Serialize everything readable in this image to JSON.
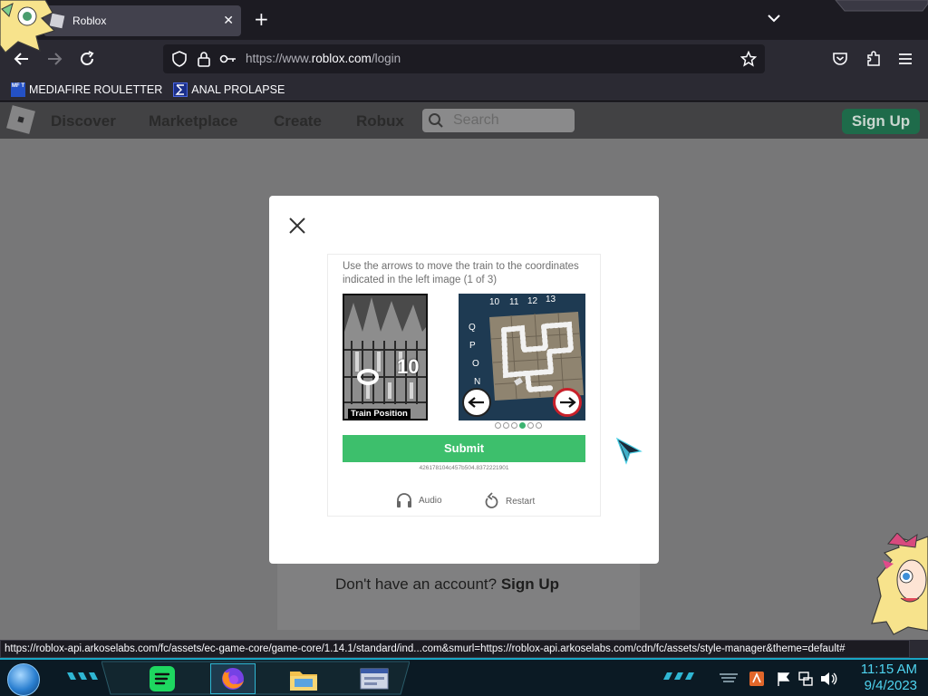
{
  "browser": {
    "tab_title": "Roblox",
    "url_prefix": "https://www.",
    "url_host": "roblox.com",
    "url_path": "/login",
    "bookmarks": [
      {
        "label": "MEDIAFIRE ROULETTER",
        "icon_text": "MF T"
      },
      {
        "label": "ANAL PROLAPSE"
      }
    ],
    "status_url": "https://roblox-api.arkoselabs.com/fc/assets/ec-game-core/game-core/1.14.1/standard/ind...com&smurl=https://roblox-api.arkoselabs.com/cdn/fc/assets/style-manager&theme=default#"
  },
  "roblox": {
    "nav": [
      "Discover",
      "Marketplace",
      "Create",
      "Robux"
    ],
    "search_placeholder": "Search",
    "signup_label": "Sign Up",
    "no_account_text": "Don't have an account?",
    "no_account_link": "Sign Up"
  },
  "captcha": {
    "instruction": "Use the arrows to move the train to the coordinates indicated in the left image (1 of 3)",
    "left_label": "Train Position",
    "left_number": "10",
    "col_labels": [
      "10",
      "11",
      "12",
      "13"
    ],
    "row_labels": [
      "Q",
      "P",
      "O",
      "N"
    ],
    "dots_total": 6,
    "dots_active_index": 3,
    "submit_label": "Submit",
    "session_id": "426178104c457b504.8372221901",
    "audio_label": "Audio",
    "restart_label": "Restart"
  },
  "taskbar": {
    "time": "11:15 AM",
    "date": "9/4/2023"
  },
  "colors": {
    "accent_green": "#3dbf6c",
    "roblox_green": "#00b06f",
    "taskbar_cyan": "#19a5c4"
  }
}
